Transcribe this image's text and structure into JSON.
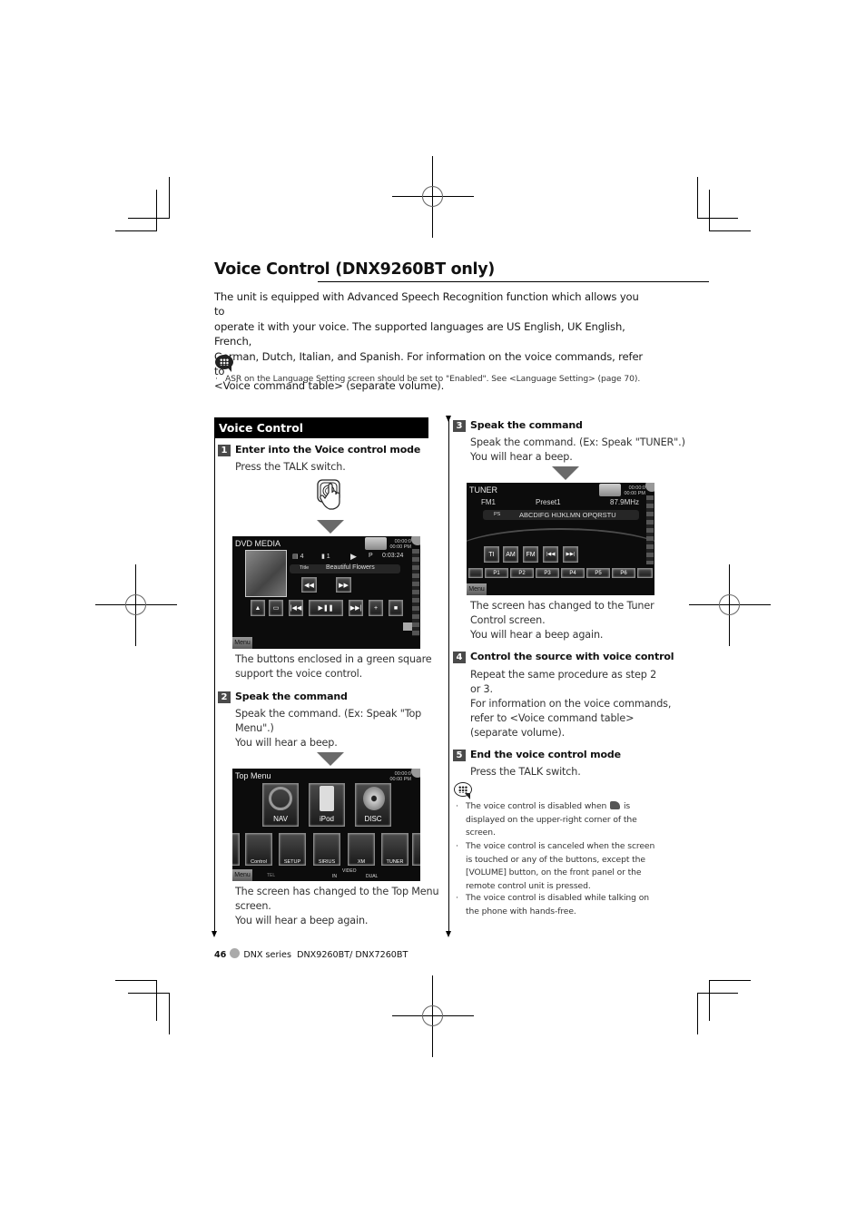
{
  "page": {
    "title_main": "Voice Control",
    "title_sub": "(DNX9260BT only)",
    "intro_lines": [
      "The unit is equipped with Advanced Speech Recognition function which allows you to",
      "operate it with your voice. The supported languages are US English, UK English, French,",
      "German, Dutch, Italian, and Spanish. For information on the voice commands, refer to",
      "<Voice command table> (separate volume)."
    ],
    "top_note_icon": "note-icon",
    "top_note": "ASR on the Language Setting screen should be set to \"Enabled\". See <Language Setting> (page 70)."
  },
  "section": {
    "title": "Voice Control"
  },
  "steps": [
    {
      "num": "1",
      "title": "Enter into the Voice control mode",
      "lines": [
        "Press the TALK switch."
      ],
      "after_lines": [
        "The buttons enclosed in a green square",
        "support the voice control."
      ]
    },
    {
      "num": "2",
      "title": "Speak the command",
      "lines": [
        "Speak the command. (Ex: Speak \"Top",
        "Menu\".)",
        "You will hear a beep."
      ],
      "after_lines": [
        "The screen has changed to the Top Menu",
        "screen.",
        "You will hear a beep again."
      ]
    },
    {
      "num": "3",
      "title": "Speak the command",
      "lines": [
        "Speak the command. (Ex: Speak \"TUNER\".)",
        "You will hear a beep."
      ],
      "after_lines": [
        "The screen has changed to the Tuner",
        "Control screen.",
        "You will hear a beep again."
      ]
    },
    {
      "num": "4",
      "title": "Control the source with voice control",
      "lines": [
        "Repeat the same procedure as step 2",
        "or 3.",
        "For information on the voice commands,",
        "refer to <Voice command table>",
        "(separate volume)."
      ]
    },
    {
      "num": "5",
      "title": "End the voice control mode",
      "lines": [
        "Press the TALK switch."
      ]
    }
  ],
  "notes": [
    [
      "The voice control is disabled when",
      "is",
      "displayed on the upper-right corner of the",
      "screen."
    ],
    [
      "The voice control is canceled when the screen",
      "is touched or any of the buttons, except the",
      "[VOLUME] button, on the front panel or the",
      "remote control unit is pressed."
    ],
    [
      "The voice control is disabled while talking on",
      "the phone with hands-free."
    ]
  ],
  "screens": {
    "dvd": {
      "title": "DVD MEDIA",
      "clock": [
        "00:00:0",
        "00:00 PM"
      ],
      "folder": "4",
      "track": "1",
      "play_mode": "P",
      "time": "0:03:24",
      "title_label": "Title",
      "track_title": "Beautiful Flowers",
      "menu": "Menu"
    },
    "top_menu": {
      "title": "Top Menu",
      "clock": [
        "00:00:0",
        "00:00 PM"
      ],
      "big_items": [
        "NAV",
        "iPod",
        "DISC"
      ],
      "small_items": [
        "Control",
        "SETUP",
        "SIRIUS",
        "XM",
        "TUNER"
      ],
      "bottom_labels": [
        "TEL",
        "IN",
        "VIDEO",
        "DUAL"
      ],
      "menu": "Menu"
    },
    "tuner": {
      "title": "TUNER",
      "clock": [
        "00:00:0",
        "00:00 PM"
      ],
      "band": "FM1",
      "preset": "Preset1",
      "frequency": "87.9MHz",
      "ps_label": "PS",
      "rds_text": "ABCDIFG HIJKLMN OPQRSTU",
      "buttons": [
        "TI",
        "AM",
        "FM",
        "|◀◀",
        "▶▶|"
      ],
      "presets": [
        "P1",
        "P2",
        "P3",
        "P4",
        "P5",
        "P6"
      ],
      "menu": "Menu"
    }
  },
  "footer": {
    "page_num": "46",
    "series": "DNX series",
    "models": "DNX9260BT/ DNX7260BT"
  }
}
